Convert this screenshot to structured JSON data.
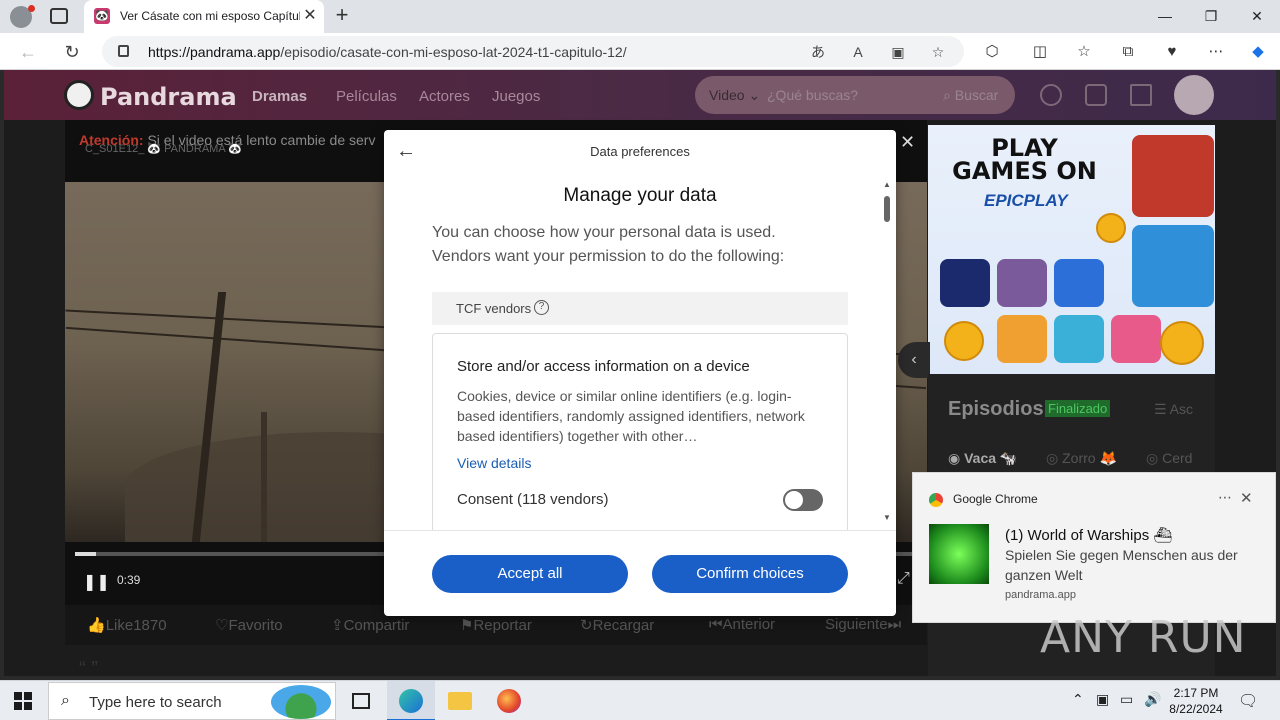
{
  "browser": {
    "tab_title": "Ver Cásate con mi esposo Capítul",
    "url_domain": "https://pandrama.app",
    "url_path": "/episodio/casate-con-mi-esposo-lat-2024-t1-capitulo-12/"
  },
  "site": {
    "name": "Pandrama",
    "nav": [
      "Dramas",
      "Películas",
      "Actores",
      "Juegos"
    ],
    "search_select": "Video",
    "search_placeholder": "¿Qué buscas?",
    "search_button": "Buscar"
  },
  "player": {
    "notice_label": "Atención:",
    "notice_text": "Si el video está lento cambie de serv",
    "watermark": "C_S01E12_ 🐼 PANDRAMA 🐼",
    "time": "0:39",
    "progress_fraction": 0.025
  },
  "actions": [
    "Like1870",
    "Favorito",
    "Compartir",
    "Reportar",
    "Recargar",
    "Anterior",
    "Siguiente"
  ],
  "ad": {
    "headline": "PLAY GAMES ON",
    "brand": "EPICPLAY"
  },
  "episodes": {
    "title": "Episodios",
    "badge": "Finalizado",
    "sort": "Asc",
    "seasons": [
      "Vaca 🐄",
      "Zorro 🦊",
      "Cerd"
    ]
  },
  "consent": {
    "header": "Data preferences",
    "title": "Manage your data",
    "lead": "You can choose how your personal data is used. Vendors want your permission to do the following:",
    "tcf_label": "TCF vendors",
    "card_title": "Store and/or access information on a device",
    "card_desc": "Cookies, device or similar online identifiers (e.g. login-based identifiers, randomly assigned identifiers, network based identifiers) together with other…",
    "view_details": "View details",
    "consent_label": "Consent (118 vendors)",
    "accept_all": "Accept all",
    "confirm_choices": "Confirm choices"
  },
  "notification": {
    "app": "Google Chrome",
    "title": "(1) World of Warships ⛴",
    "body": "Spielen Sie gegen Menschen aus der ganzen Welt",
    "source": "pandrama.app"
  },
  "watermark": "ANY RUN",
  "taskbar": {
    "search_placeholder": "Type here to search",
    "time": "2:17 PM",
    "date": "8/22/2024"
  }
}
